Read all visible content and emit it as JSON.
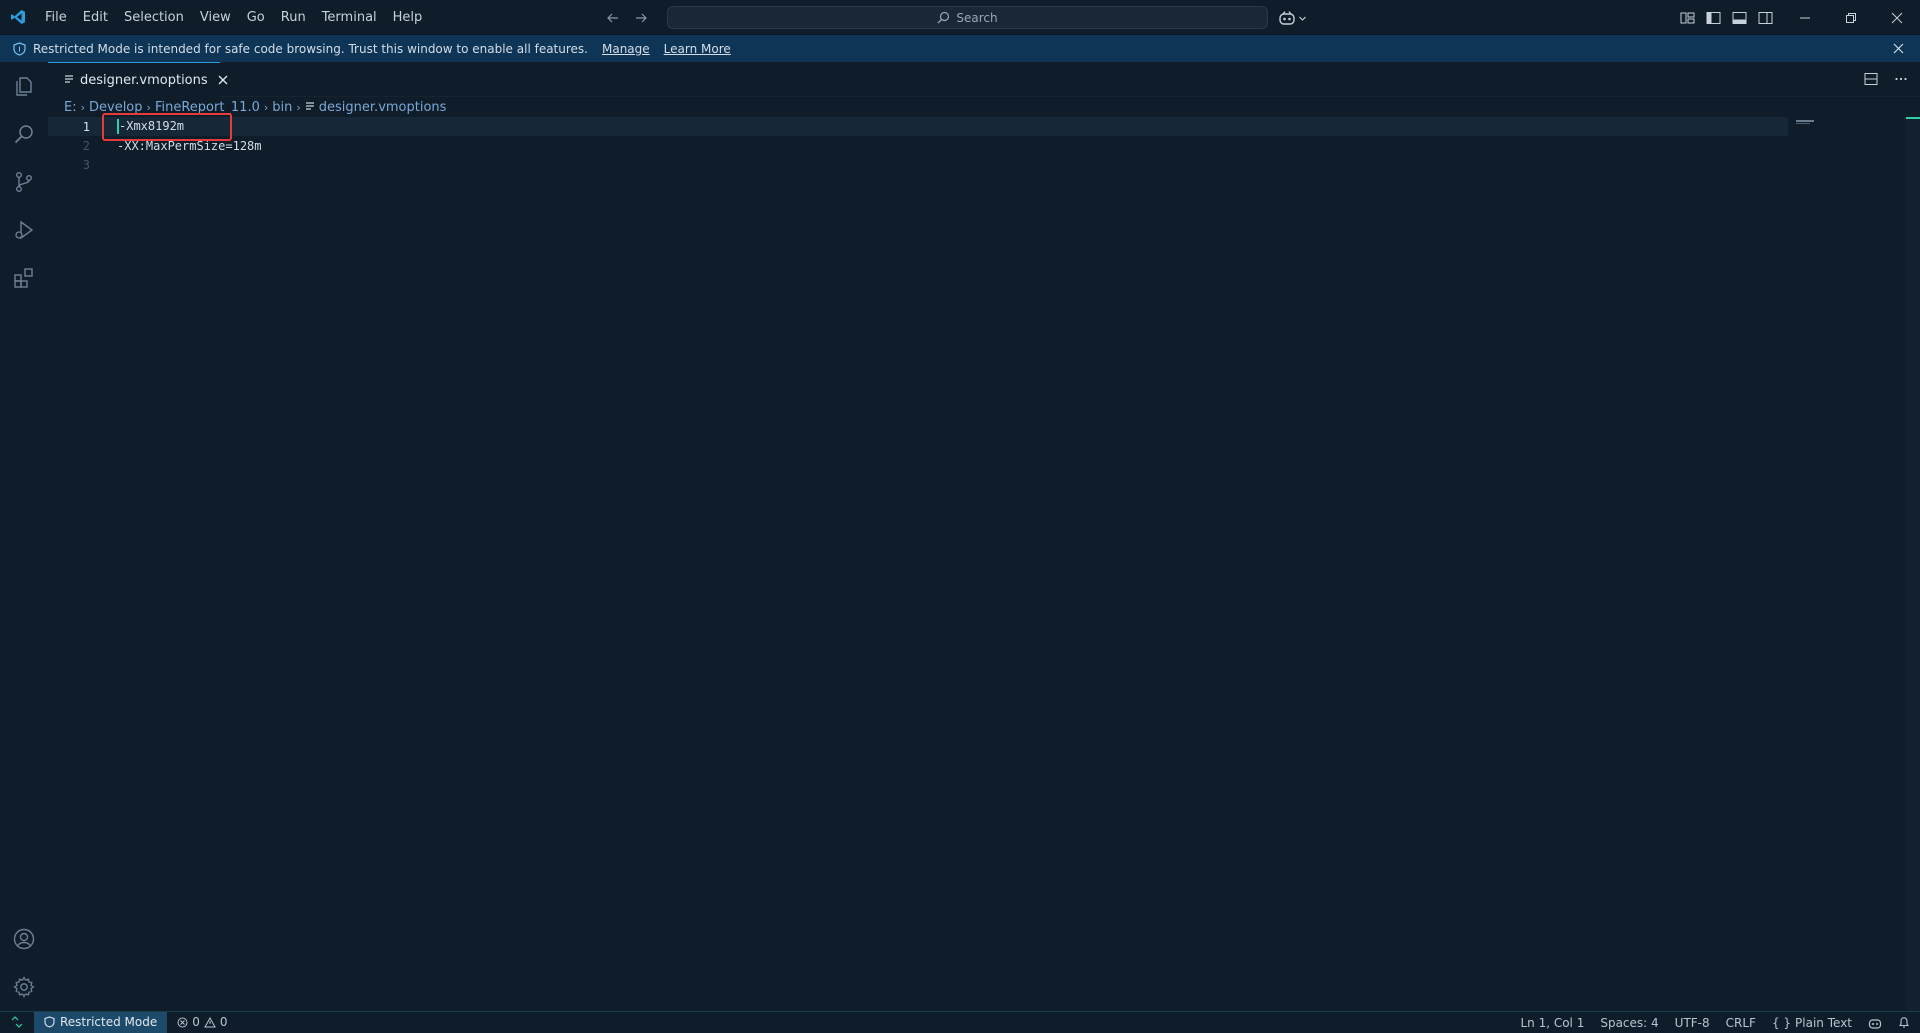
{
  "menu": [
    "File",
    "Edit",
    "Selection",
    "View",
    "Go",
    "Run",
    "Terminal",
    "Help"
  ],
  "command_center": {
    "label": "Search"
  },
  "banner": {
    "text": "Restricted Mode is intended for safe code browsing. Trust this window to enable all features.",
    "manage": "Manage",
    "learn_more": "Learn More"
  },
  "tab": {
    "label": "designer.vmoptions"
  },
  "breadcrumb": [
    "E:",
    "Develop",
    "FineReport_11.0",
    "bin",
    "designer.vmoptions"
  ],
  "editor": {
    "lines": [
      {
        "number": "1",
        "text": "-Xmx8192m"
      },
      {
        "number": "2",
        "text": "-XX:MaxPermSize=128m"
      },
      {
        "number": "3",
        "text": ""
      }
    ]
  },
  "status": {
    "restricted": "Restricted Mode",
    "errors": "0",
    "warnings": "0",
    "position": "Ln 1, Col 1",
    "spaces": "Spaces: 4",
    "encoding": "UTF-8",
    "eol": "CRLF",
    "language": "Plain Text"
  },
  "colors": {
    "background": "#0f1c2a",
    "banner": "#0e3556",
    "accent": "#2bd2a8",
    "highlight": "#e53b3b",
    "link": "#7aa8d4"
  }
}
